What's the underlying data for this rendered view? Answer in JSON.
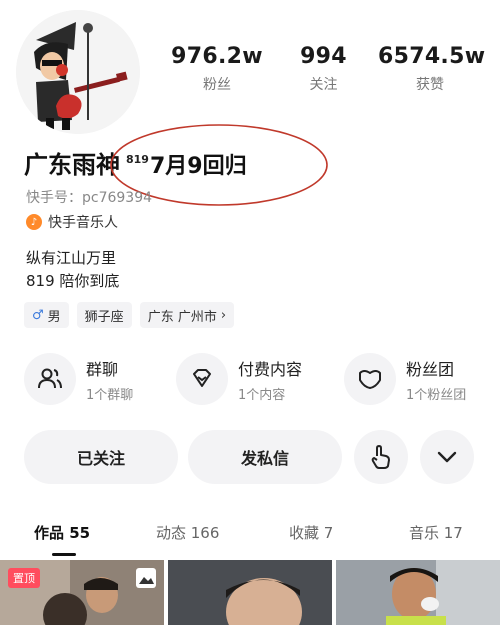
{
  "profile": {
    "name": "广东雨神",
    "sup_number": "819",
    "name_suffix": "7月9回归",
    "kuaishou_id": "快手号：pc769394",
    "badge": "快手音乐人",
    "bio_line1": "纵有江山万里",
    "bio_line2": "819 陪你到底"
  },
  "stats": [
    {
      "value": "976.2w",
      "label": "粉丝"
    },
    {
      "value": "994",
      "label": "关注"
    },
    {
      "value": "6574.5w",
      "label": "获赞"
    }
  ],
  "tags": {
    "gender": "男",
    "zodiac": "狮子座",
    "location": "广东 广州市",
    "chevron": "›"
  },
  "features": [
    {
      "title": "群聊",
      "sub": "1个群聊",
      "icon": "group-chat-icon"
    },
    {
      "title": "付费内容",
      "sub": "1个内容",
      "icon": "diamond-icon"
    },
    {
      "title": "粉丝团",
      "sub": "1个粉丝团",
      "icon": "heart-icon"
    }
  ],
  "actions": {
    "followed": "已关注",
    "message": "发私信"
  },
  "tabs": [
    {
      "label": "作品 55"
    },
    {
      "label": "动态 166"
    },
    {
      "label": "收藏 7"
    },
    {
      "label": "音乐 17"
    }
  ],
  "video_grid": {
    "pin_label": "置顶"
  },
  "colors": {
    "accent_orange": "#ff8a2a",
    "annotation_red": "#c0392b",
    "male_blue": "#3c7bdc",
    "pin_red": "#ff4d5e"
  }
}
